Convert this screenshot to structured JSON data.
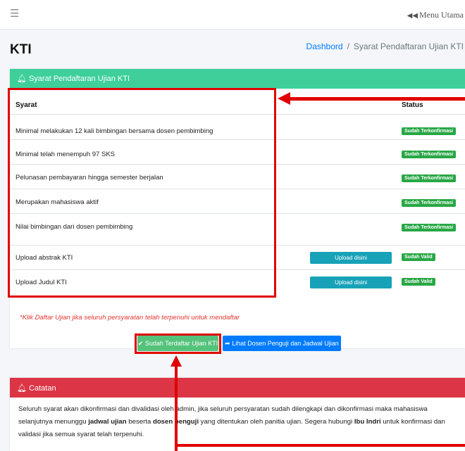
{
  "topbar": {
    "menu_icon": "hamburger-icon",
    "back_icon": "double-left-arrow-icon",
    "back_arrow": "◀◀",
    "menu_label": "Menu Utama"
  },
  "page": {
    "title": "KTI",
    "breadcrumb": {
      "home": "Dashbord",
      "separator": "/",
      "current": "Syarat Pendaftaran Ujian KTI"
    }
  },
  "requirements_card": {
    "header_icon": "bell-icon",
    "header": "Syarat Pendaftaran Ujian KTI",
    "header_color": "#3ecf9b",
    "columns": {
      "requirement": "Syarat",
      "status": "Status"
    },
    "rows": [
      {
        "label": "Minimal melakukan 12 kali bimbingan bersama dosen pembimbing",
        "status": "Sudah Terkonfirmasi"
      },
      {
        "label": "Minimal telah menempuh 97 SKS",
        "status": "Sudah Terkonfirmasi"
      },
      {
        "label": "Pelunasan pembayaran hingga semester berjalan",
        "status": "Sudah Terkonfirmasi"
      },
      {
        "label": "Merupakan mahasiswa aktif",
        "status": "Sudah Terkonfirmasi"
      },
      {
        "label": "Nilai bimbingan dari dosen pembimbing",
        "status": "Sudah Terkonfirmasi"
      },
      {
        "label": "Upload abstrak KTI",
        "button": "Upload disini",
        "status": "Sudah Valid"
      },
      {
        "label": "Upload Judul KTI",
        "button": "Upload disini",
        "status": "Sudah Valid"
      }
    ],
    "badge_color": "#28a745",
    "upload_color": "#17a2b8",
    "note": "*Klik Daftar Ujian jika seluruh persyaratan telah terpenuhi untuk mendaftar",
    "registered_icon": "check-icon",
    "registered_button": "Sudah Terdaftar Ujian KTI",
    "view_icon": "share-arrow-icon",
    "view_button": "Lihat Dosen Penguji dan Jadwal Ujian"
  },
  "notes_card": {
    "header_icon": "bell-icon",
    "header": "Catatan",
    "header_color": "#dc3545",
    "body": {
      "part1": "Seluruh syarat akan dikonfirmasi dan divalidasi oleh admin, jika seluruh persyaratan sudah dilengkapi dan dikonfirmasi maka mahasiswa selanjutnya menunggu ",
      "bold1": "jadwal ujian",
      "part2": " beserta ",
      "bold2": "dosen penguji",
      "part3": " yang ditentukan oleh panitia ujian. Segera hubungi ",
      "bold3": "Ibu Indri",
      "part4": " untuk konfirmasi dan validasi jika semua syarat telah terpenuhi."
    }
  },
  "annotation_color": "#e00000"
}
